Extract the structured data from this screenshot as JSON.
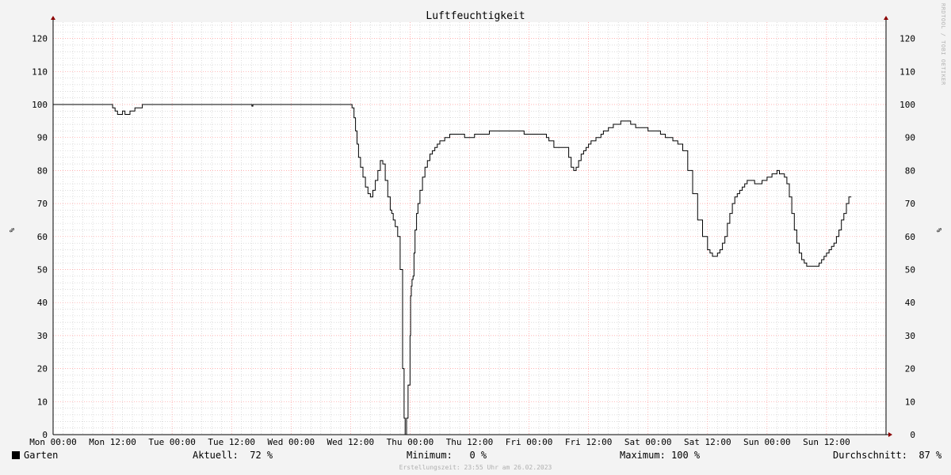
{
  "chart_data": {
    "type": "line",
    "title": "Luftfeuchtigkeit",
    "ylabel": "%",
    "xlabel": "",
    "ylim": [
      0,
      125
    ],
    "yticks": [
      0,
      10,
      20,
      30,
      40,
      50,
      60,
      70,
      80,
      90,
      100,
      110,
      120
    ],
    "xlim": [
      0,
      168
    ],
    "xticks": [
      {
        "h": 0,
        "label": "Mon 00:00"
      },
      {
        "h": 12,
        "label": "Mon 12:00"
      },
      {
        "h": 24,
        "label": "Tue 00:00"
      },
      {
        "h": 36,
        "label": "Tue 12:00"
      },
      {
        "h": 48,
        "label": "Wed 00:00"
      },
      {
        "h": 60,
        "label": "Wed 12:00"
      },
      {
        "h": 72,
        "label": "Thu 00:00"
      },
      {
        "h": 84,
        "label": "Thu 12:00"
      },
      {
        "h": 96,
        "label": "Fri 00:00"
      },
      {
        "h": 108,
        "label": "Fri 12:00"
      },
      {
        "h": 120,
        "label": "Sat 00:00"
      },
      {
        "h": 132,
        "label": "Sat 12:00"
      },
      {
        "h": 144,
        "label": "Sun 00:00"
      },
      {
        "h": 156,
        "label": "Sun 12:00"
      }
    ],
    "grid": true,
    "series": [
      {
        "name": "Garten",
        "color": "#000000",
        "x_hours": [
          0,
          11.5,
          12.0,
          12.5,
          13.0,
          13.5,
          14.0,
          14.5,
          15.0,
          15.5,
          16.0,
          16.5,
          17.0,
          17.5,
          18.0,
          18.5,
          19.0,
          39.9,
          40.1,
          40.3,
          60.0,
          60.3,
          60.7,
          61.0,
          61.3,
          61.6,
          62.0,
          62.5,
          63.0,
          63.5,
          64.0,
          64.5,
          65.0,
          65.5,
          66.0,
          66.5,
          67.0,
          67.5,
          68.0,
          68.3,
          68.6,
          69.0,
          69.5,
          70.0,
          70.5,
          70.8,
          71.0,
          71.3,
          71.6,
          72.0,
          72.1,
          72.25,
          72.4,
          72.6,
          72.8,
          73.0,
          73.3,
          73.6,
          74.0,
          74.5,
          75.0,
          75.5,
          76.0,
          76.5,
          77.0,
          77.5,
          78.0,
          79.0,
          80.0,
          81.0,
          82.0,
          83.0,
          85.0,
          88.0,
          90.0,
          92.0,
          95.0,
          98.0,
          99.0,
          99.5,
          100.0,
          101.0,
          104.0,
          104.5,
          105.0,
          105.5,
          106.0,
          106.5,
          107.0,
          107.5,
          108.0,
          108.5,
          109.0,
          109.5,
          110.0,
          110.5,
          111.0,
          111.5,
          112.0,
          112.5,
          113.0,
          113.5,
          114.0,
          114.5,
          115.0,
          115.5,
          116.0,
          116.5,
          117.0,
          117.5,
          118.0,
          118.5,
          119.0,
          119.5,
          120.0,
          121.0,
          122.0,
          122.5,
          123.0,
          123.5,
          124.0,
          125.0,
          126.0,
          127.0,
          128.0,
          129.0,
          130.0,
          131.0,
          132.0,
          132.5,
          133.0,
          133.5,
          134.0,
          134.5,
          135.0,
          135.5,
          136.0,
          136.5,
          137.0,
          137.5,
          138.0,
          138.5,
          139.0,
          139.5,
          140.0,
          140.5,
          141.0,
          141.5,
          142.0,
          142.5,
          143.0,
          143.5,
          144.0,
          144.5,
          145.0,
          145.5,
          146.0,
          146.5,
          147.0,
          147.5,
          148.0,
          148.5,
          149.0,
          149.5,
          150.0,
          150.5,
          151.0,
          151.5,
          152.0,
          152.5,
          153.0,
          153.5,
          154.0,
          154.5,
          155.0,
          155.5,
          156.0,
          156.5,
          157.0,
          157.5,
          158.0,
          158.5,
          159.0,
          159.5,
          160.0,
          160.5,
          161.0,
          161.5,
          162.0,
          162.5,
          163.0,
          163.5,
          164.0,
          164.5,
          165.0,
          165.5,
          166.0,
          166.5,
          167.0,
          167.3
        ],
        "values": [
          100,
          100,
          99,
          98,
          97,
          97,
          98,
          97,
          97,
          98,
          98,
          99,
          99,
          99,
          100,
          100,
          100,
          100,
          99.5,
          100,
          100,
          99,
          96,
          92,
          88,
          84,
          81,
          78,
          75,
          73,
          72,
          74,
          77,
          80,
          83,
          82,
          77,
          72,
          68,
          67,
          65,
          63,
          60,
          50,
          20,
          5,
          0,
          5,
          15,
          30,
          42,
          45,
          47,
          48,
          55,
          62,
          67,
          70,
          74,
          78,
          81,
          83,
          85,
          86,
          87,
          88,
          89,
          90,
          91,
          91,
          91,
          90,
          91,
          92,
          92,
          92,
          91,
          91,
          91,
          90,
          89,
          87,
          84,
          81,
          80,
          81,
          83,
          85,
          86,
          87,
          88,
          89,
          89,
          90,
          90,
          91,
          92,
          92,
          93,
          93,
          94,
          94,
          94,
          95,
          95,
          95,
          95,
          94,
          94,
          93,
          93,
          93,
          93,
          93,
          92,
          92,
          92,
          91,
          91,
          90,
          90,
          89,
          88,
          86,
          80,
          73,
          65,
          60,
          56,
          55,
          54,
          54,
          55,
          56,
          58,
          60,
          64,
          67,
          70,
          72,
          73,
          74,
          75,
          76,
          77,
          77,
          77,
          76,
          76,
          76,
          77,
          77,
          78,
          78,
          79,
          79,
          80,
          79,
          79,
          78,
          76,
          72,
          67,
          62,
          58,
          55,
          53,
          52,
          51,
          51,
          51,
          51,
          51,
          52,
          53,
          54,
          55,
          56,
          57,
          58,
          60,
          62,
          65,
          67,
          70,
          72
        ]
      }
    ]
  },
  "legend": {
    "series_label": "Garten",
    "aktuell": "Aktuell:  72 %",
    "minimum": "Minimum:   0 %",
    "maximum": "Maximum: 100 %",
    "durchschnitt": "Durchschnitt:  87 %"
  },
  "footer_text": "Erstellungszeit: 23:55 Uhr am 26.02.2023",
  "watermark_text": "RRDTOOL / TOBI OETIKER",
  "colors": {
    "background": "#f3f3f3",
    "plot_background": "#ffffff",
    "major_grid": "#ff9898",
    "minor_grid": "#c8c8c8",
    "axis_arrow": "#8b0000",
    "line": "#000000"
  }
}
